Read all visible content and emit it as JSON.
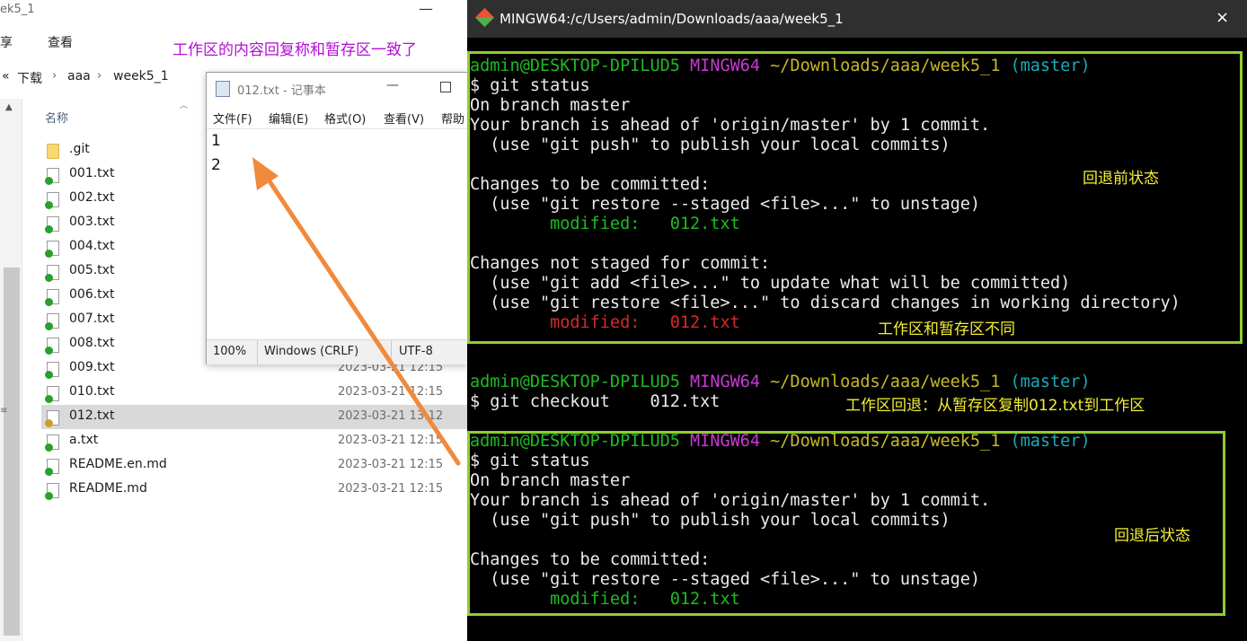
{
  "explorer": {
    "title_fragment": "ek5_1",
    "menu": [
      "享",
      "查看"
    ],
    "breadcrumb": [
      "下载",
      "aaa",
      "week5_1"
    ],
    "nav_prefix": "«",
    "column_name": "名称",
    "left_mark": "≡",
    "files": [
      {
        "name": ".git",
        "date": "",
        "kind": "folder"
      },
      {
        "name": "001.txt",
        "date": "",
        "kind": "tracked"
      },
      {
        "name": "002.txt",
        "date": "",
        "kind": "tracked"
      },
      {
        "name": "003.txt",
        "date": "",
        "kind": "tracked"
      },
      {
        "name": "004.txt",
        "date": "",
        "kind": "tracked"
      },
      {
        "name": "005.txt",
        "date": "",
        "kind": "tracked"
      },
      {
        "name": "006.txt",
        "date": "",
        "kind": "tracked"
      },
      {
        "name": "007.txt",
        "date": "",
        "kind": "tracked"
      },
      {
        "name": "008.txt",
        "date": "",
        "kind": "tracked"
      },
      {
        "name": "009.txt",
        "date": "2023-03-21 12:15",
        "kind": "tracked"
      },
      {
        "name": "010.txt",
        "date": "2023-03-21 12:15",
        "kind": "tracked"
      },
      {
        "name": "012.txt",
        "date": "2023-03-21 13:12",
        "kind": "modified"
      },
      {
        "name": "a.txt",
        "date": "2023-03-21 12:15",
        "kind": "tracked"
      },
      {
        "name": "README.en.md",
        "date": "2023-03-21 12:15",
        "kind": "tracked"
      },
      {
        "name": "README.md",
        "date": "2023-03-21 12:15",
        "kind": "tracked"
      }
    ]
  },
  "notepad": {
    "title": "012.txt - 记事本",
    "menu": [
      "文件(F)",
      "编辑(E)",
      "格式(O)",
      "查看(V)",
      "帮助"
    ],
    "lines": [
      "1",
      "2"
    ],
    "status": {
      "zoom": "100%",
      "eol": "Windows (CRLF)",
      "encoding": "UTF-8"
    }
  },
  "terminal": {
    "title": "MINGW64:/c/Users/admin/Downloads/aaa/week5_1",
    "prompt": {
      "user": "admin@DESKTOP-DPILUD5",
      "env": "MINGW64",
      "path": "~/Downloads/aaa/week5_1",
      "branch": "(master)"
    },
    "cmd_status": "$ git status",
    "cmd_checkout": "$ git checkout    012.txt",
    "on_branch": "On branch master",
    "ahead": "Your branch is ahead of 'origin/master' by 1 commit.",
    "push_hint": "  (use \"git push\" to publish your local commits)",
    "to_be_committed": "Changes to be committed:",
    "restore_staged_hint": "  (use \"git restore --staged <file>...\" to unstage)",
    "modified_line": "        modified:   012.txt",
    "not_staged": "Changes not staged for commit:",
    "add_hint": "  (use \"git add <file>...\" to update what will be committed)",
    "restore_hint": "  (use \"git restore <file>...\" to discard changes in working directory)"
  },
  "annotations": {
    "top_purple": "工作区的内容回复称和暂存区一致了",
    "before_state": "回退前状态",
    "diff_note": "工作区和暂存区不同",
    "checkout_note": "工作区回退：从暂存区复制012.txt到工作区",
    "after_state": "回退后状态"
  },
  "colors": {
    "box_green": "#8fce2e",
    "annotation_yellow": "#f3ee35",
    "annotation_purple": "#b40fd4",
    "arrow_orange": "#f08a3c"
  }
}
